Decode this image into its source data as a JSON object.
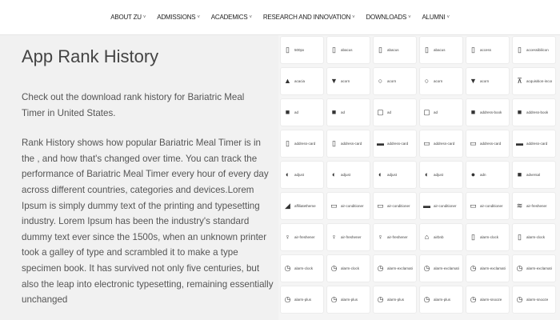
{
  "nav": {
    "items": [
      {
        "label": "ABOUT ZU",
        "chevron": "˅"
      },
      {
        "label": "ADMISSIONS",
        "chevron": "˅"
      },
      {
        "label": "ACADEMICS",
        "chevron": "˅"
      },
      {
        "label": "RESEARCH AND INNOVATION",
        "chevron": "˅"
      },
      {
        "label": "DOWNLOADS",
        "chevron": "˅"
      },
      {
        "label": "ALUMNI",
        "chevron": "˅"
      }
    ]
  },
  "main": {
    "title": "App Rank History",
    "intro": "Check out the download rank history for Bariatric Meal Timer in United States.",
    "body": "Rank History shows how popular Bariatric Meal Timer is in the , and how that's changed over time. You can track the performance of Bariatric Meal Timer every hour of every day across different countries, categories and devices.Lorem Ipsum is simply dummy text of the printing and typesetting industry. Lorem Ipsum has been the industry's standard dummy text ever since the 1500s, when an unknown printer took a galley of type and scrambled it to make a type specimen book. It has survived not only five centuries, but also the leap into electronic typesetting, remaining essentially unchanged"
  },
  "icon_grid": {
    "rows": [
      [
        {
          "icon": "▯",
          "icon_name": "500px-icon",
          "label": "500px"
        },
        {
          "icon": "▯",
          "icon_name": "abacus-icon",
          "label": "abacus"
        },
        {
          "icon": "▯",
          "icon_name": "abacus-icon",
          "label": "abacus"
        },
        {
          "icon": "▯",
          "icon_name": "abacus-icon",
          "label": "abacus"
        },
        {
          "icon": "▯",
          "icon_name": "access-icon",
          "label": "access"
        },
        {
          "icon": "▯",
          "icon_name": "accessibility-icon",
          "label": "accessibilicon"
        }
      ],
      [
        {
          "icon": "▲",
          "icon_name": "acorn-icon",
          "label": "acacia"
        },
        {
          "icon": "▼",
          "icon_name": "acorn-icon",
          "label": "acorn"
        },
        {
          "icon": "○",
          "icon_name": "acorn-icon",
          "label": "acorn"
        },
        {
          "icon": "○",
          "icon_name": "acorn-icon",
          "label": "acorn"
        },
        {
          "icon": "▼",
          "icon_name": "acorn-icon",
          "label": "acorn"
        },
        {
          "icon": "⊼",
          "icon_name": "acquisition-icon",
          "label": "acquisition-incorporated"
        }
      ],
      [
        {
          "icon": "■",
          "icon_name": "ad-icon",
          "label": "ad"
        },
        {
          "icon": "■",
          "icon_name": "ad-icon",
          "label": "ad"
        },
        {
          "icon": "▢",
          "icon_name": "ad-icon",
          "label": "ad"
        },
        {
          "icon": "▢",
          "icon_name": "ad-icon",
          "label": "ad"
        },
        {
          "icon": "■",
          "icon_name": "address-book-icon",
          "label": "address-book"
        },
        {
          "icon": "■",
          "icon_name": "address-book-icon",
          "label": "address-book"
        }
      ],
      [
        {
          "icon": "▯",
          "icon_name": "address-card-icon",
          "label": "address-card"
        },
        {
          "icon": "▯",
          "icon_name": "address-card-icon",
          "label": "address-card"
        },
        {
          "icon": "▬",
          "icon_name": "address-card-icon",
          "label": "address-card"
        },
        {
          "icon": "▭",
          "icon_name": "address-card-icon",
          "label": "address-card"
        },
        {
          "icon": "▭",
          "icon_name": "address-card-icon",
          "label": "address-card"
        },
        {
          "icon": "▬",
          "icon_name": "address-card-icon",
          "label": "address-card"
        }
      ],
      [
        {
          "icon": "◐",
          "icon_name": "adjust-icon",
          "label": "adjust"
        },
        {
          "icon": "◐",
          "icon_name": "adjust-icon",
          "label": "adjust"
        },
        {
          "icon": "◐",
          "icon_name": "adjust-icon",
          "label": "adjust"
        },
        {
          "icon": "◐",
          "icon_name": "adjust-icon",
          "label": "adjust"
        },
        {
          "icon": "●",
          "icon_name": "adn-icon",
          "label": "adn"
        },
        {
          "icon": "■",
          "icon_name": "adversal-icon",
          "label": "adversal"
        }
      ],
      [
        {
          "icon": "◢",
          "icon_name": "affiliatetheme-icon",
          "label": "affiliatetheme"
        },
        {
          "icon": "▭",
          "icon_name": "air-conditioner-icon",
          "label": "air-conditioner"
        },
        {
          "icon": "▭",
          "icon_name": "air-conditioner-icon",
          "label": "air-conditioner"
        },
        {
          "icon": "▬",
          "icon_name": "air-conditioner-icon",
          "label": "air-conditioner"
        },
        {
          "icon": "▭",
          "icon_name": "air-conditioner-icon",
          "label": "air-conditioner"
        },
        {
          "icon": "≋",
          "icon_name": "air-freshener-icon",
          "label": "air-freshener"
        }
      ],
      [
        {
          "icon": "♀",
          "icon_name": "air-freshener-icon",
          "label": "air-freshener"
        },
        {
          "icon": "♀",
          "icon_name": "air-freshener-icon",
          "label": "air-freshener"
        },
        {
          "icon": "♀",
          "icon_name": "air-freshener-icon",
          "label": "air-freshener"
        },
        {
          "icon": "⌂",
          "icon_name": "airbnb-icon",
          "label": "airbnb"
        },
        {
          "icon": "▯",
          "icon_name": "alarm-clock-icon",
          "label": "alarm-clock"
        },
        {
          "icon": "▯",
          "icon_name": "alarm-clock-icon",
          "label": "alarm-clock"
        }
      ],
      [
        {
          "icon": "◷",
          "icon_name": "alarm-clock-icon",
          "label": "alarm-clock"
        },
        {
          "icon": "◷",
          "icon_name": "alarm-clock-icon",
          "label": "alarm-clock"
        },
        {
          "icon": "◷",
          "icon_name": "alarm-exclamation-icon",
          "label": "alarm-exclamation"
        },
        {
          "icon": "◷",
          "icon_name": "alarm-exclamation-icon",
          "label": "alarm-exclamation"
        },
        {
          "icon": "◷",
          "icon_name": "alarm-exclamation-icon",
          "label": "alarm-exclamation"
        },
        {
          "icon": "◷",
          "icon_name": "alarm-exclamation-icon",
          "label": "alarm-exclamation"
        }
      ],
      [
        {
          "icon": "◷",
          "icon_name": "alarm-plus-icon",
          "label": "alarm-plus"
        },
        {
          "icon": "◷",
          "icon_name": "alarm-plus-icon",
          "label": "alarm-plus"
        },
        {
          "icon": "◷",
          "icon_name": "alarm-plus-icon",
          "label": "alarm-plus"
        },
        {
          "icon": "◷",
          "icon_name": "alarm-plus-icon",
          "label": "alarm-plus"
        },
        {
          "icon": "◷",
          "icon_name": "alarm-snooze-icon",
          "label": "alarm-snooze"
        },
        {
          "icon": "◷",
          "icon_name": "alarm-snooze-icon",
          "label": "alarm-snooze"
        }
      ]
    ]
  }
}
